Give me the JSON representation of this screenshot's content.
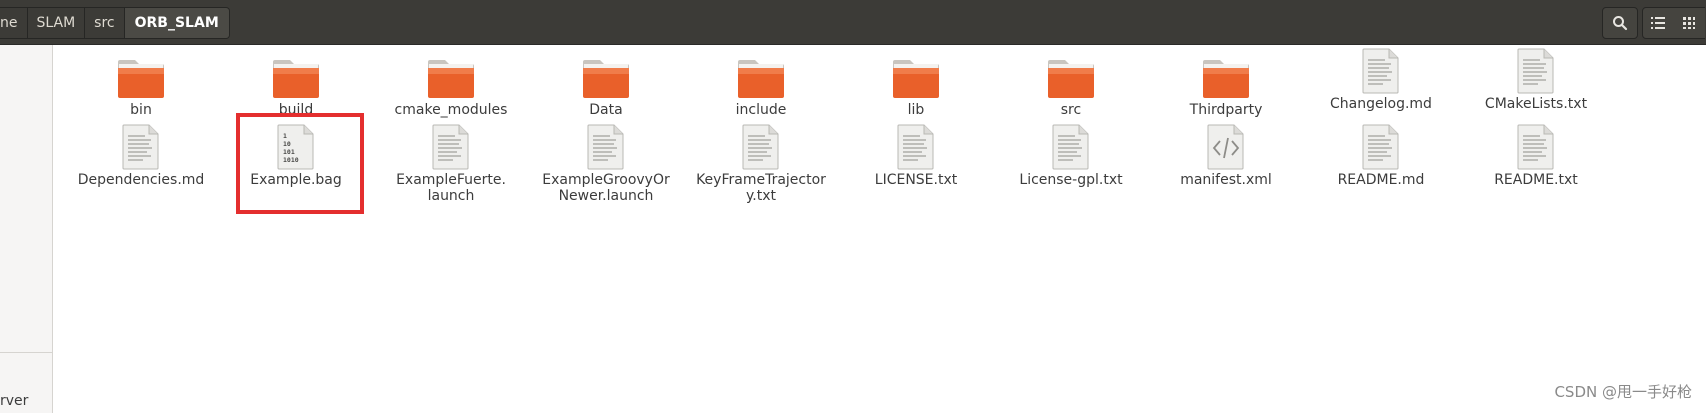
{
  "breadcrumbs": [
    "ne",
    "SLAM",
    "src",
    "ORB_SLAM"
  ],
  "header_icons": [
    "search-icon",
    "list-view-icon",
    "grid-view-icon"
  ],
  "sidebar": {
    "partial_label": "rver"
  },
  "files": [
    {
      "name": "bin",
      "type": "folder"
    },
    {
      "name": "build",
      "type": "folder"
    },
    {
      "name": "cmake_modules",
      "type": "folder"
    },
    {
      "name": "Data",
      "type": "folder"
    },
    {
      "name": "include",
      "type": "folder"
    },
    {
      "name": "lib",
      "type": "folder"
    },
    {
      "name": "src",
      "type": "folder"
    },
    {
      "name": "Thirdparty",
      "type": "folder"
    },
    {
      "name": "Changelog.md",
      "type": "text"
    },
    {
      "name": "CMakeLists.txt",
      "type": "text"
    },
    {
      "name": "Dependencies.md",
      "type": "text"
    },
    {
      "name": "Example.bag",
      "type": "binary"
    },
    {
      "name": "ExampleFuerte.\nlaunch",
      "type": "text"
    },
    {
      "name": "ExampleGroovyOr\nNewer.launch",
      "type": "text"
    },
    {
      "name": "KeyFrameTrajector\ny.txt",
      "type": "text"
    },
    {
      "name": "LICENSE.txt",
      "type": "text"
    },
    {
      "name": "License-gpl.txt",
      "type": "text"
    },
    {
      "name": "manifest.xml",
      "type": "xml"
    },
    {
      "name": "README.md",
      "type": "text"
    },
    {
      "name": "README.txt",
      "type": "text"
    }
  ],
  "binary_icon_text": [
    "1",
    "10",
    "101",
    "1010"
  ],
  "watermark": "CSDN @甩一手好枪",
  "colors": {
    "header_bg": "#3c3b37",
    "folder_orange": "#e9602a",
    "highlight_red": "#e42e2e"
  }
}
